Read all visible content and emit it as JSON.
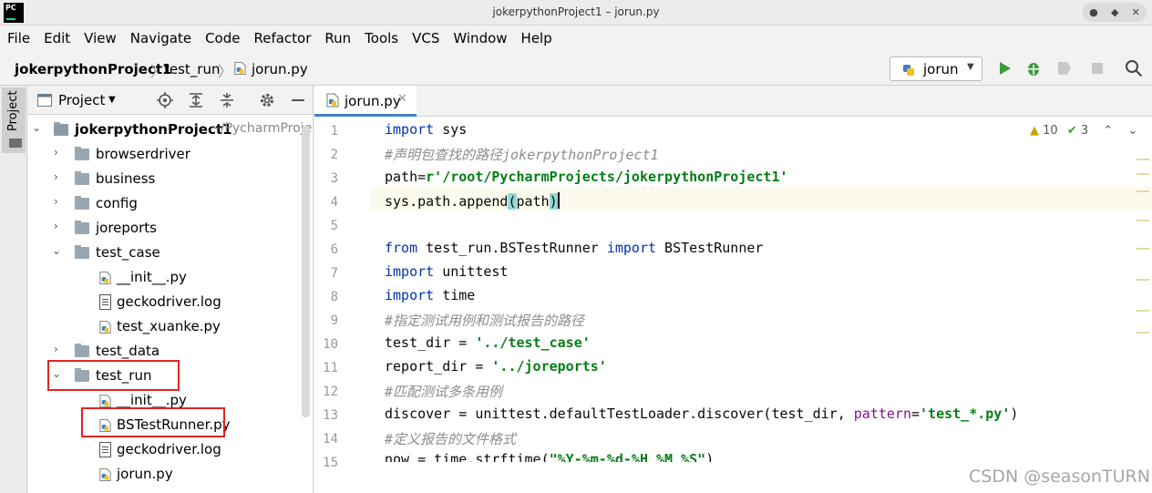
{
  "window": {
    "title": "jokerpythonProject1 – jorun.py",
    "app_logo": "PC"
  },
  "menu": [
    "File",
    "Edit",
    "View",
    "Navigate",
    "Code",
    "Refactor",
    "Run",
    "Tools",
    "VCS",
    "Window",
    "Help"
  ],
  "breadcrumb": {
    "project": "jokerpythonProject1",
    "folder": "test_run",
    "file": "jorun.py"
  },
  "run_config": {
    "label": "jorun"
  },
  "left_stripe": {
    "tab_label": "Project"
  },
  "project_panel": {
    "title": "Project",
    "root": {
      "name": "jokerpythonProject1",
      "path": "~/PycharmProject"
    },
    "tree": [
      {
        "label": "browserdriver",
        "type": "folder",
        "expanded": false
      },
      {
        "label": "business",
        "type": "folder",
        "expanded": false
      },
      {
        "label": "config",
        "type": "folder",
        "expanded": false
      },
      {
        "label": "joreports",
        "type": "folder",
        "expanded": false
      },
      {
        "label": "test_case",
        "type": "folder",
        "expanded": true
      },
      {
        "label": "__init__.py",
        "type": "python"
      },
      {
        "label": "geckodriver.log",
        "type": "log"
      },
      {
        "label": "test_xuanke.py",
        "type": "python"
      },
      {
        "label": "test_data",
        "type": "folder",
        "expanded": false
      },
      {
        "label": "test_run",
        "type": "folder",
        "expanded": true
      },
      {
        "label": "__init__.py",
        "type": "python"
      },
      {
        "label": "BSTestRunner.py",
        "type": "python"
      },
      {
        "label": "geckodriver.log",
        "type": "log"
      },
      {
        "label": "jorun.py",
        "type": "python"
      }
    ]
  },
  "editor": {
    "tab_label": "jorun.py",
    "inspections": {
      "warnings": "10",
      "weak_warnings": "3"
    },
    "line_numbers": [
      "1",
      "2",
      "3",
      "4",
      "5",
      "6",
      "7",
      "8",
      "9",
      "10",
      "11",
      "12",
      "13",
      "14",
      "15"
    ],
    "code": {
      "l1_kw": "import",
      "l1_rest": " sys",
      "l2": "#声明包查找的路径jokerpythonProject1",
      "l3_a": "path=",
      "l3_str": "r'/root/PycharmProjects/jokerpythonProject1'",
      "l4_a": "sys.path.append",
      "l4_paren": "(",
      "l4_b": "path",
      "l4_close": ")",
      "l6_kw1": "from",
      "l6_a": " test_run.BSTestRunner ",
      "l6_kw2": "import",
      "l6_b": " BSTestRunner",
      "l7_kw": "import",
      "l7_rest": " unittest",
      "l8_kw": "import",
      "l8_rest": " time",
      "l9": "#指定测试用例和测试报告的路径",
      "l10_a": "test_dir = ",
      "l10_str": "'../test_case'",
      "l11_a": "report_dir = ",
      "l11_str": "'../joreports'",
      "l12": "#匹配测试多条用例",
      "l13_a": "discover = unittest.defaultTestLoader.discover(test_dir, ",
      "l13_param": "pattern",
      "l13_eq": "=",
      "l13_str": "'test_*.py'",
      "l13_close": ")",
      "l14": "#定义报告的文件格式",
      "l15_a": "now = time.strftime(",
      "l15_str": "\"%Y-%m-%d-%H_%M_%S\"",
      "l15_close": ")"
    }
  },
  "watermark": "CSDN @seasonTURN",
  "colors": {
    "keyword": "#0033b3",
    "comment": "#8c8c8c",
    "string": "#067d17",
    "param": "#871094",
    "highlight_box": "#e02424",
    "run_green": "#3d9a3d"
  }
}
